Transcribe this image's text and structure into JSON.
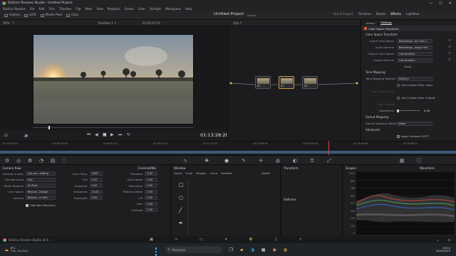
{
  "window": {
    "title": "DaVinci Resolve Studio - Untitled Project",
    "controls": [
      "—",
      "☐",
      "✕"
    ]
  },
  "menu": [
    "DaVinci Resolve",
    "File",
    "Edit",
    "Trim",
    "Timeline",
    "Clip",
    "Mark",
    "View",
    "Playback",
    "Fusion",
    "Color",
    "Fairlight",
    "Workspace",
    "Help"
  ],
  "toolbar": {
    "gallery": "Gallery",
    "luts": "LUTs",
    "media_pool": "Media Pool",
    "clips": "Clips",
    "project_title": "Untitled Project",
    "edited": "Edited",
    "quick_export": "Quick Export",
    "timeline": "Timeline",
    "nodes": "Nodes",
    "effects": "Effects",
    "lightbox": "Lightbox"
  },
  "viewer_bar": {
    "zoom": "35%",
    "timeline_name": "Timeline 1",
    "timecode": "21:05:07:17",
    "clip_mode": "Clip"
  },
  "viewer": {
    "timecode": "01:13:28:20"
  },
  "nodes": [
    {
      "label": "01"
    },
    {
      "label": "02"
    },
    {
      "label": "03"
    }
  ],
  "inspector": {
    "tabs": [
      "Library",
      "Settings"
    ],
    "effect_name": "Color Space Transform",
    "section_cst": "Color Space Transform",
    "fields": [
      {
        "k": "Input Color Space",
        "v": "Blackmagi...llm Gen 1"
      },
      {
        "k": "Input Gamma",
        "v": "Blackmagi...esign Film"
      },
      {
        "k": "Output Color Space",
        "v": "Use timeline"
      },
      {
        "k": "Output Gamma",
        "v": "Use timeline"
      }
    ],
    "swap": "Swap",
    "section_tone": "Tone Mapping",
    "tone_method_label": "Tone Mapping Method",
    "tone_method": "DaVinci",
    "use_custom_input": "Use Custom Max. Input",
    "max_input_label": "Max. Input (nits)",
    "use_custom_output": "Use Custom Max. Output",
    "max_output_label": "Max. Output",
    "adaptation_label": "Adaptation",
    "adaptation_value": "9.00",
    "section_gamut": "Gamut Mapping",
    "gamut_method_label": "Gamut Mapping Method",
    "gamut_method": "None",
    "section_advanced": "Advanced",
    "apply_forward_ootf": "Apply Forward OOTF"
  },
  "timeline_ruler": [
    "01:07:35:00",
    "01:08:39:03",
    "01:09:43:12",
    "01:10:47:17",
    "01:11:51:22",
    "01:12:56:00",
    "01:14:00:04",
    "01:15:04:08",
    "01:16:08:12"
  ],
  "camera_raw": {
    "title": "Camera Raw",
    "format": "CinemaDNG",
    "left": [
      {
        "k": "Decode Quality",
        "v": "Use pro...setting"
      },
      {
        "k": "Decode Using",
        "v": "Clip"
      },
      {
        "k": "White Balance",
        "v": "As Shot"
      },
      {
        "k": "Color Space",
        "v": "Blackm...Design"
      },
      {
        "k": "Gamma",
        "v": "Blackm...m Film"
      }
    ],
    "highlight_recovery": "Highlight Recovery",
    "mid": [
      {
        "k": "Color Temp",
        "v": "4499"
      },
      {
        "k": "Tint",
        "v": "0.55"
      },
      {
        "k": "Exposure",
        "v": "0.00"
      },
      {
        "k": "Sharpness",
        "v": "10.00"
      },
      {
        "k": "Highlights",
        "v": "0.00"
      }
    ],
    "right": [
      {
        "k": "Shadows",
        "v": "0.00"
      },
      {
        "k": "Color Boost",
        "v": "0.00"
      },
      {
        "k": "Saturation",
        "v": "0.00"
      },
      {
        "k": "Midtone Detail",
        "v": "0.00"
      },
      {
        "k": "Lift",
        "v": "0.00"
      },
      {
        "k": "Gain",
        "v": "0.00"
      },
      {
        "k": "Contrast",
        "v": "0.00"
      }
    ]
  },
  "window_panel": {
    "title": "Window",
    "tools": [
      "Linear",
      "Circle",
      "Polygon",
      "Curve",
      "Gradient"
    ],
    "delete": "Delete"
  },
  "transform_panel": {
    "title": "Transform",
    "softness": "Softness"
  },
  "scopes": {
    "title": "Scopes",
    "mode": "Waveform",
    "ticks": [
      "1023",
      "896",
      "768",
      "640",
      "512",
      "384",
      "256",
      "128",
      "0"
    ]
  },
  "status": {
    "app": "DaVinci Resolve Studio 18.6"
  },
  "taskbar": {
    "weather": "8°C",
    "weather_desc": "Geb. Nublado",
    "search": "Pesquisar",
    "time": "20:12",
    "date": "18/12/2023"
  }
}
